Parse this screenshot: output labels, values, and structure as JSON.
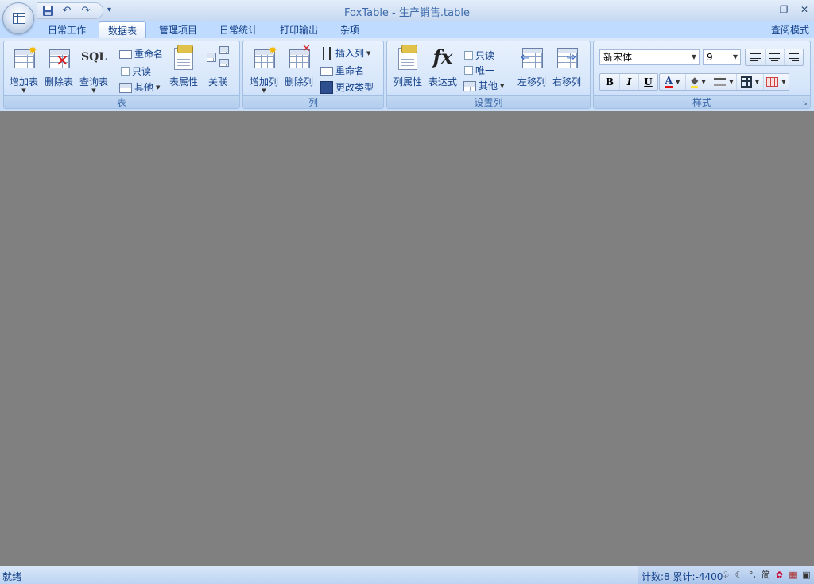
{
  "window": {
    "title": "FoxTable - 生产销售.table",
    "minimize_icon": "minimize-icon",
    "restore_icon": "restore-icon",
    "close_icon": "close-icon"
  },
  "tabs": [
    {
      "label": "日常工作"
    },
    {
      "label": "数据表"
    },
    {
      "label": "管理项目"
    },
    {
      "label": "日常统计"
    },
    {
      "label": "打印输出"
    },
    {
      "label": "杂项"
    }
  ],
  "active_tab": "数据表",
  "view_mode": "查阅模式",
  "ribbon": {
    "table_group": {
      "label": "表",
      "add_table": "增加表",
      "delete_table": "删除表",
      "query_table": "查询表",
      "sql_text": "SQL",
      "rename": "重命名",
      "readonly": "只读",
      "other": "其他",
      "properties": "表属性",
      "relation": "关联"
    },
    "column_group": {
      "label": "列",
      "add_column": "增加列",
      "delete_column": "删除列",
      "insert_column": "插入列",
      "rename": "重命名",
      "change_type": "更改类型"
    },
    "set_column_group": {
      "label": "设置列",
      "column_properties": "列属性",
      "expression": "表达式",
      "fx_text": "fx",
      "readonly": "只读",
      "unique": "唯一",
      "other": "其他",
      "move_left": "左移列",
      "move_right": "右移列"
    },
    "style_group": {
      "label": "样式",
      "font_name": "新宋体",
      "font_size": "9",
      "bold": "B",
      "italic": "I",
      "underline": "U",
      "font_color": "A"
    }
  },
  "statusbar": {
    "status": "就绪",
    "summary": "计数:8 累计:-4400"
  },
  "colors": {
    "workspace": "#808080",
    "accent": "#15428b"
  }
}
